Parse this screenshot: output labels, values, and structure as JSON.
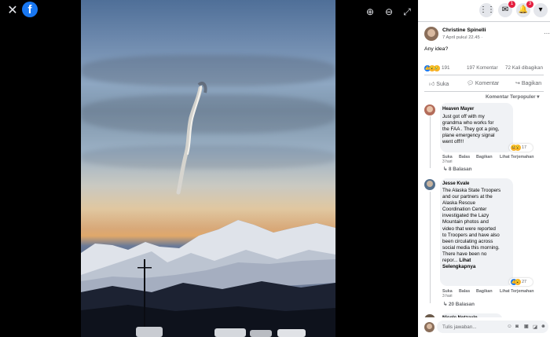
{
  "viewer": {
    "close_icon": "close-icon",
    "logo_icon": "facebook-logo",
    "tools": [
      "zoom-in-icon",
      "zoom-out-icon",
      "fullscreen-icon"
    ]
  },
  "topbar": {
    "icons": [
      "grid-menu-icon",
      "messenger-icon",
      "notifications-icon",
      "account-dropdown-icon"
    ],
    "messenger_badge": "1",
    "notifications_badge": "3"
  },
  "post": {
    "author": "Christine Spinelli",
    "time": "7 April pukul 22.45 ·",
    "text": "Any idea?",
    "reaction_count": "191",
    "comments_count": "197 Komentar",
    "shares_count": "72 Kali dibagikan",
    "actions": {
      "like": "Suka",
      "comment": "Komentar",
      "share": "Bagikan"
    },
    "sort_label": "Komentar Terpopuler"
  },
  "comments": [
    {
      "author": "Heaven Mayer",
      "lines": [
        "Just got off with my",
        "grandma who works for",
        "the FAA . They got a ping,",
        "plane emergency signal",
        "went off!!!"
      ],
      "reactions": "17",
      "actions": [
        "Suka",
        "Balas",
        "Bagikan",
        "Lihat Terjemahan"
      ],
      "age": "3 hari",
      "replies": "8 Balasan"
    },
    {
      "author": "Jesse Kvale",
      "lines": [
        "The Alaska State Troopers",
        "and our partners at the",
        "Alaska Rescue",
        "Coordination Center",
        "investigated the Lazy",
        "Mountain photos and",
        "video that were reported",
        "to Troopers and have also",
        "been circulating across",
        "social media this morning.",
        "There have been no",
        "repor..."
      ],
      "see_more": "Lihat",
      "see_more_2": "Selengkapnya",
      "reactions": "27",
      "actions": [
        "Suka",
        "Balas",
        "Bagikan",
        "Lihat Terjemahan"
      ],
      "age": "3 hari",
      "replies": "20 Balasan"
    },
    {
      "author": "Nicole Notzavin"
    }
  ],
  "reply_box": {
    "placeholder": "Tulis jawaban..."
  },
  "colors": {
    "facebook_blue": "#1877f2",
    "badge_red": "#e41e3f",
    "reply_blue": "#216fdb"
  }
}
